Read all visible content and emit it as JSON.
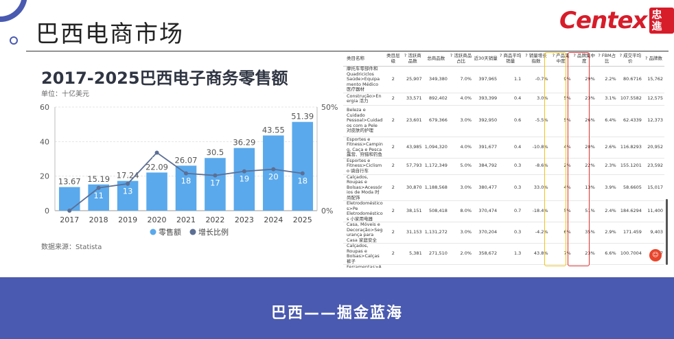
{
  "slide": {
    "title": "巴西电商市场",
    "logo_text": "Centex",
    "logo_cn": "忠進",
    "footer": "巴西——掘金蓝海"
  },
  "chart_data": {
    "type": "bar",
    "title": "2017-2025巴西电子商务零售额",
    "unit": "单位：十亿美元",
    "source": "数据来源：Statista",
    "categories": [
      "2017",
      "2018",
      "2019",
      "2020",
      "2021",
      "2022",
      "2023",
      "2024",
      "2025"
    ],
    "ylim_left": [
      0,
      60
    ],
    "left_ticks": [
      "60",
      "40",
      "20",
      "0"
    ],
    "ylim_right": [
      0,
      50
    ],
    "right_ticks": [
      "50%",
      "0%"
    ],
    "series": [
      {
        "name": "零售额",
        "kind": "bar",
        "color": "#5aa9ec",
        "values": [
          13.67,
          15.19,
          17.24,
          22.09,
          26.07,
          30.5,
          36.29,
          43.55,
          51.39
        ],
        "labels": [
          "13.67",
          "15.19",
          "17.24",
          "22.09",
          "26.07",
          "30.5",
          "36.29",
          "43.55",
          "51.39"
        ]
      },
      {
        "name": "增长比例",
        "kind": "line",
        "color": "#5c6f94",
        "values": [
          0,
          11,
          13,
          28,
          18,
          17,
          19,
          20,
          18
        ],
        "labels": [
          "",
          "11",
          "13",
          "28",
          "18",
          "17",
          "19",
          "20",
          "18"
        ]
      }
    ],
    "legend_position": "bottom-center",
    "grid": true
  },
  "table": {
    "headers": [
      "类目名称",
      "类目层级",
      "? 活跃商品数",
      "总商品数",
      "? 活跃商品占比",
      "近30天销量",
      "? 商品平均销量",
      "? 销量增长指数",
      "? 产品集中度",
      "? 品牌集中度",
      "? FBM占比",
      "? 成交平均价",
      "? 品牌数"
    ],
    "rows": [
      [
        "摩托车零部件和Quadriciclos Saúde>Equipamento Médico 医疗器材",
        "2",
        "25,907",
        "349,380",
        "7.0%",
        "397,965",
        "1.1",
        "-0.7%",
        "9%",
        "29%",
        "2.2%",
        "80.6716",
        "15,762"
      ],
      [
        "Construção>Energia 活力",
        "2",
        "33,571",
        "892,402",
        "4.0%",
        "393,399",
        "0.4",
        "3.0%",
        "5%",
        "23%",
        "3.1%",
        "107.5582",
        "12,575"
      ],
      [
        "Beleza e Cuidado Pessoal>Cuidados com a Pele 对皮肤的护理",
        "2",
        "23,601",
        "679,366",
        "3.0%",
        "392,950",
        "0.6",
        "-5.5%",
        "5%",
        "26%",
        "6.4%",
        "62.4339",
        "12,373"
      ],
      [
        "Esportes e Fitness>Camping, Caça e Pesca 露营、狩猎和钓鱼",
        "2",
        "43,985",
        "1,094,320",
        "4.0%",
        "391,677",
        "0.4",
        "-10.8%",
        "4%",
        "20%",
        "2.6%",
        "116.8293",
        "20,952"
      ],
      [
        "Esportes e Fitness>Ciclismo 骑自行车",
        "2",
        "57,793",
        "1,172,349",
        "5.0%",
        "384,792",
        "0.3",
        "-8.6%",
        "2%",
        "22%",
        "2.3%",
        "155.1201",
        "23,592"
      ],
      [
        "Calçados, Roupas e Bolsas>Acessórios de Moda 时尚配饰",
        "2",
        "30,870",
        "1,188,568",
        "3.0%",
        "380,477",
        "0.3",
        "33.0%",
        "4%",
        "13%",
        "3.9%",
        "58.6605",
        "15,017"
      ],
      [
        "Eletrodomésticos>Pe Eletrodomésticos 小家用电器",
        "2",
        "38,151",
        "508,418",
        "8.0%",
        "370,474",
        "0.7",
        "-18.4%",
        "5%",
        "51%",
        "2.4%",
        "184.6294",
        "11,400"
      ],
      [
        "Casa, Móveis e Decoração>Segurança para Casa 家庭安全",
        "2",
        "31,153",
        "1,131,272",
        "3.0%",
        "370,204",
        "0.3",
        "-4.2%",
        "6%",
        "35%",
        "2.9%",
        "171.459",
        "9,403"
      ],
      [
        "Calçados, Roupas e Bolsas>Calças 裤子",
        "2",
        "5,381",
        "271,510",
        "2.0%",
        "358,672",
        "1.3",
        "43.8%",
        "7%",
        "23%",
        "6.6%",
        "100.7004",
        "3,037"
      ],
      [
        "Ferramentas>Acessórios para Ferramentas 配件工具",
        "2",
        "36,517",
        "1,227,101",
        "3.0%",
        "337,774",
        "0.3",
        "0.4%",
        "4%",
        "23%",
        "5.1%",
        "92.2644",
        "10,244"
      ]
    ]
  }
}
